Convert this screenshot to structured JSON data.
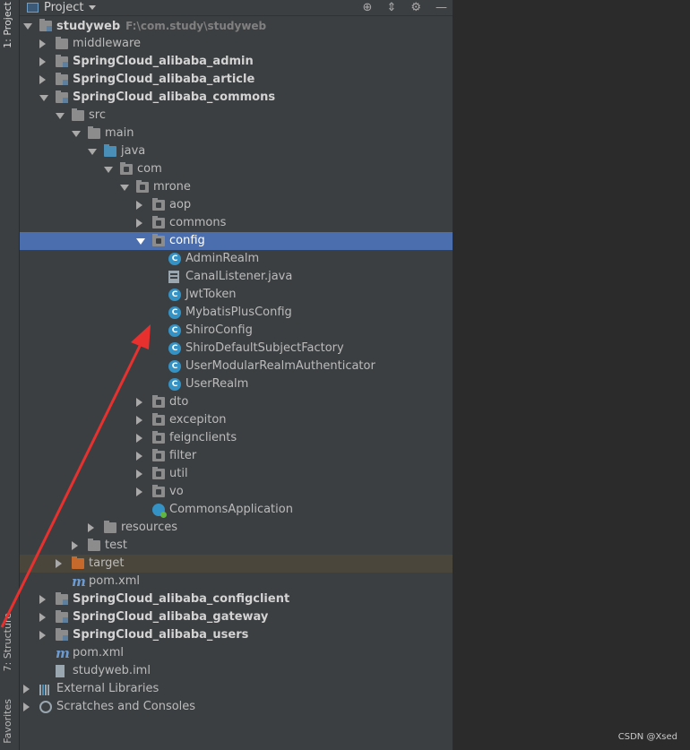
{
  "side_tabs": {
    "project": "1: Project",
    "structure": "7: Structure",
    "favorites": "Favorites"
  },
  "toolbar": {
    "title": "Project"
  },
  "tree": [
    {
      "label": "studyweb",
      "extra": "F:\\com.study\\studyweb",
      "bold": true,
      "indent": 0,
      "arrow": "open",
      "icon": "folder-module"
    },
    {
      "label": "middleware",
      "indent": 1,
      "arrow": "closed",
      "icon": "folder"
    },
    {
      "label": "SpringCloud_alibaba_admin",
      "bold": true,
      "indent": 1,
      "arrow": "closed",
      "icon": "folder-module"
    },
    {
      "label": "SpringCloud_alibaba_article",
      "bold": true,
      "indent": 1,
      "arrow": "closed",
      "icon": "folder-module"
    },
    {
      "label": "SpringCloud_alibaba_commons",
      "bold": true,
      "indent": 1,
      "arrow": "open",
      "icon": "folder-module"
    },
    {
      "label": "src",
      "indent": 2,
      "arrow": "open",
      "icon": "folder"
    },
    {
      "label": "main",
      "indent": 3,
      "arrow": "open",
      "icon": "folder"
    },
    {
      "label": "java",
      "indent": 4,
      "arrow": "open",
      "icon": "folder-blue"
    },
    {
      "label": "com",
      "indent": 5,
      "arrow": "open",
      "icon": "folder-pkg"
    },
    {
      "label": "mrone",
      "indent": 6,
      "arrow": "open",
      "icon": "folder-pkg"
    },
    {
      "label": "aop",
      "indent": 7,
      "arrow": "closed",
      "icon": "folder-pkg"
    },
    {
      "label": "commons",
      "indent": 7,
      "arrow": "closed",
      "icon": "folder-pkg"
    },
    {
      "label": "config",
      "indent": 7,
      "arrow": "open",
      "icon": "folder-pkg",
      "selected": true
    },
    {
      "label": "AdminRealm",
      "indent": 8,
      "icon": "class"
    },
    {
      "label": "CanalListener.java",
      "indent": 8,
      "icon": "java-file"
    },
    {
      "label": "JwtToken",
      "indent": 8,
      "icon": "class"
    },
    {
      "label": "MybatisPlusConfig",
      "indent": 8,
      "icon": "class"
    },
    {
      "label": "ShiroConfig",
      "indent": 8,
      "icon": "class"
    },
    {
      "label": "ShiroDefaultSubjectFactory",
      "indent": 8,
      "icon": "class"
    },
    {
      "label": "UserModularRealmAuthenticator",
      "indent": 8,
      "icon": "class"
    },
    {
      "label": "UserRealm",
      "indent": 8,
      "icon": "class"
    },
    {
      "label": "dto",
      "indent": 7,
      "arrow": "closed",
      "icon": "folder-pkg"
    },
    {
      "label": "excepiton",
      "indent": 7,
      "arrow": "closed",
      "icon": "folder-pkg"
    },
    {
      "label": "feignclients",
      "indent": 7,
      "arrow": "closed",
      "icon": "folder-pkg"
    },
    {
      "label": "filter",
      "indent": 7,
      "arrow": "closed",
      "icon": "folder-pkg"
    },
    {
      "label": "util",
      "indent": 7,
      "arrow": "closed",
      "icon": "folder-pkg"
    },
    {
      "label": "vo",
      "indent": 7,
      "arrow": "closed",
      "icon": "folder-pkg"
    },
    {
      "label": "CommonsApplication",
      "indent": 7,
      "icon": "spring-app"
    },
    {
      "label": "resources",
      "indent": 4,
      "arrow": "closed",
      "icon": "folder"
    },
    {
      "label": "test",
      "indent": 3,
      "arrow": "closed",
      "icon": "folder"
    },
    {
      "label": "target",
      "indent": 2,
      "arrow": "closed",
      "icon": "folder-orange",
      "excluded": true
    },
    {
      "label": "pom.xml",
      "indent": 2,
      "icon": "maven"
    },
    {
      "label": "SpringCloud_alibaba_configclient",
      "bold": true,
      "indent": 1,
      "arrow": "closed",
      "icon": "folder-module"
    },
    {
      "label": "SpringCloud_alibaba_gateway",
      "bold": true,
      "indent": 1,
      "arrow": "closed",
      "icon": "folder-module"
    },
    {
      "label": "SpringCloud_alibaba_users",
      "bold": true,
      "indent": 1,
      "arrow": "closed",
      "icon": "folder-module"
    },
    {
      "label": "pom.xml",
      "indent": 1,
      "icon": "maven"
    },
    {
      "label": "studyweb.iml",
      "indent": 1,
      "icon": "iml"
    },
    {
      "label": "External Libraries",
      "indent": 0,
      "arrow": "closed",
      "icon": "libraries"
    },
    {
      "label": "Scratches and Consoles",
      "indent": 0,
      "arrow": "closed",
      "icon": "scratches"
    }
  ],
  "watermark": "CSDN @Xsed",
  "colors": {
    "selection": "#4b6eaf",
    "annotation_arrow": "#e8312f"
  }
}
